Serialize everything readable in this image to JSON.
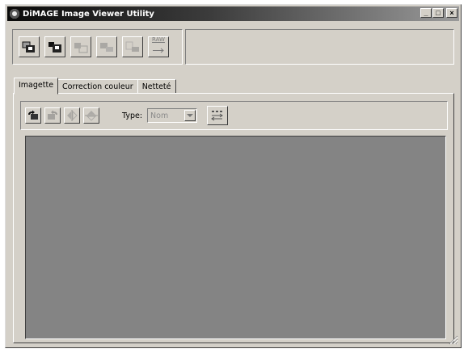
{
  "window": {
    "title": "DiMAGE Image Viewer Utility",
    "caption_buttons": {
      "minimize": "_",
      "maximize": "□",
      "close": "×"
    }
  },
  "main_toolbar": {
    "buttons": [
      {
        "icon": "open-folder-icon",
        "enabled": true
      },
      {
        "icon": "save-icon",
        "enabled": true
      },
      {
        "icon": "print-icon",
        "enabled": false
      },
      {
        "icon": "edit-image-icon",
        "enabled": false
      },
      {
        "icon": "batch-icon",
        "enabled": false
      },
      {
        "icon": "raw-convert-icon",
        "enabled": false,
        "label": "RAW"
      }
    ]
  },
  "tabs": [
    {
      "label": "Imagette",
      "active": true
    },
    {
      "label": "Correction couleur",
      "active": false
    },
    {
      "label": "Netteté",
      "active": false
    }
  ],
  "thumbnail_toolbar": {
    "buttons": [
      {
        "icon": "rotate-left-icon",
        "enabled": true
      },
      {
        "icon": "rotate-right-icon",
        "enabled": false
      },
      {
        "icon": "flip-horizontal-icon",
        "enabled": false
      },
      {
        "icon": "flip-vertical-icon",
        "enabled": false
      }
    ],
    "type_label": "Type:",
    "type_select": {
      "value": "Nom"
    },
    "sort_button_icon": "sort-order-icon"
  },
  "colors": {
    "face": "#d4d0c8",
    "thumbnail_area": "#848484",
    "title_gradient_start": "#0a0a0a"
  }
}
